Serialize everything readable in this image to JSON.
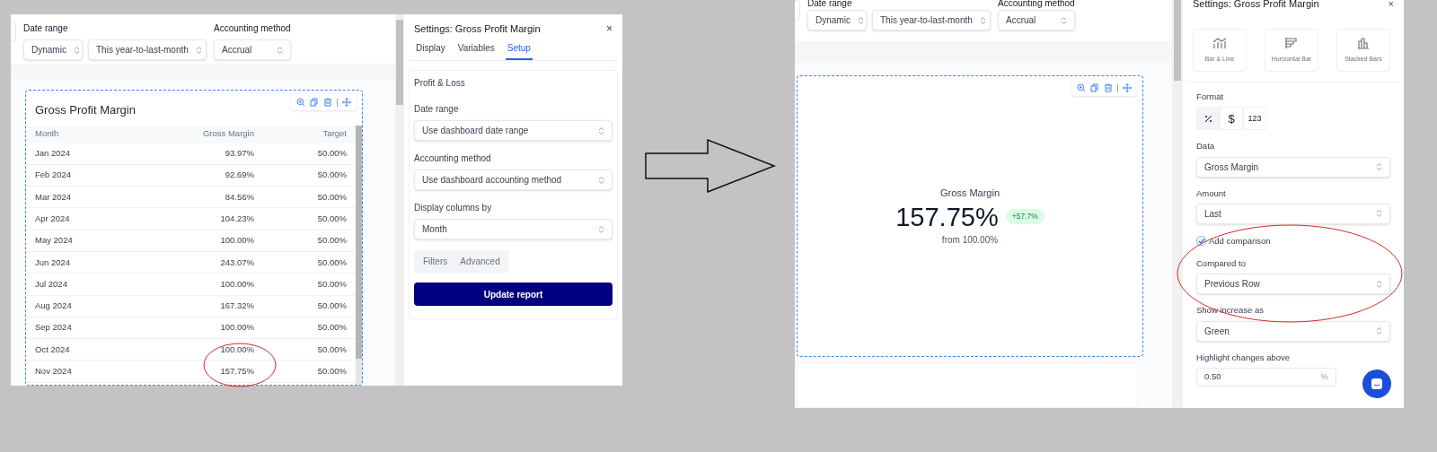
{
  "before_screenshot": {
    "filters": {
      "date_range_label": "Date range",
      "accounting_method_label": "Accounting method",
      "date_mode": "Dynamic",
      "date_preset": "This year-to-last-month",
      "accounting_method": "Accrual"
    },
    "widget": {
      "title": "Gross Profit Margin",
      "columns": [
        "Month",
        "Gross Margin",
        "Target"
      ],
      "rows": [
        [
          "Jan 2024",
          "93.97%",
          "50.00%"
        ],
        [
          "Feb 2024",
          "92.69%",
          "50.00%"
        ],
        [
          "Mar 2024",
          "84.56%",
          "50.00%"
        ],
        [
          "Apr 2024",
          "104.23%",
          "50.00%"
        ],
        [
          "May 2024",
          "100.00%",
          "50.00%"
        ],
        [
          "Jun 2024",
          "243.07%",
          "50.00%"
        ],
        [
          "Jul 2024",
          "100.00%",
          "50.00%"
        ],
        [
          "Aug 2024",
          "167.32%",
          "50.00%"
        ],
        [
          "Sep 2024",
          "100.00%",
          "50.00%"
        ],
        [
          "Oct 2024",
          "100.00%",
          "50.00%"
        ],
        [
          "Nov 2024",
          "157.75%",
          "50.00%"
        ]
      ]
    },
    "settings": {
      "title": "Settings: Gross Profit Margin",
      "close": "×",
      "tabs": [
        {
          "label": "Display",
          "selected": false
        },
        {
          "label": "Variables",
          "selected": false
        },
        {
          "label": "Setup",
          "selected": true
        }
      ],
      "section_title": "Profit & Loss",
      "fields": [
        {
          "label": "Date range",
          "value": "Use dashboard date range"
        },
        {
          "label": "Accounting method",
          "value": "Use dashboard accounting method"
        },
        {
          "label": "Display columns by",
          "value": "Month"
        }
      ],
      "subtabs": [
        "Filters",
        "Advanced"
      ],
      "button": "Update report"
    }
  },
  "after_screenshot": {
    "filters": {
      "date_range_label": "Date range",
      "accounting_method_label": "Accounting method",
      "date_mode": "Dynamic",
      "date_preset": "This year-to-last-month",
      "accounting_method": "Accrual"
    },
    "widget": {
      "metric_label": "Gross Margin",
      "value": "157.75%",
      "change": "+57.7%",
      "comparison": "from 100.00%"
    },
    "settings": {
      "title": "Settings: Gross Profit Margin",
      "close": "×",
      "chart_types": [
        {
          "kind": "bar-line",
          "label": "Bar & Line"
        },
        {
          "kind": "horizontal",
          "label": "Horizontal Bar"
        },
        {
          "kind": "stacked",
          "label": "Stacked Bars"
        }
      ],
      "format_label": "Format",
      "format_options": [
        {
          "kind": "percent",
          "selected": true
        },
        {
          "kind": "text",
          "label": "$",
          "selected": false
        },
        {
          "kind": "text",
          "label": "123",
          "selected": false
        }
      ],
      "fields": [
        {
          "kind": "select",
          "label": "Data",
          "value": "Gross Margin"
        },
        {
          "kind": "select",
          "label": "Amount",
          "value": "Last"
        },
        {
          "kind": "checkbox",
          "label": "Add comparison",
          "checked": true
        },
        {
          "kind": "select",
          "label": "Compared to",
          "value": "Previous Row"
        },
        {
          "kind": "select",
          "label": "Show increase as",
          "value": "Green"
        },
        {
          "kind": "input",
          "label": "Highlight changes above",
          "value": "0.50",
          "suffix": "%"
        }
      ]
    }
  }
}
